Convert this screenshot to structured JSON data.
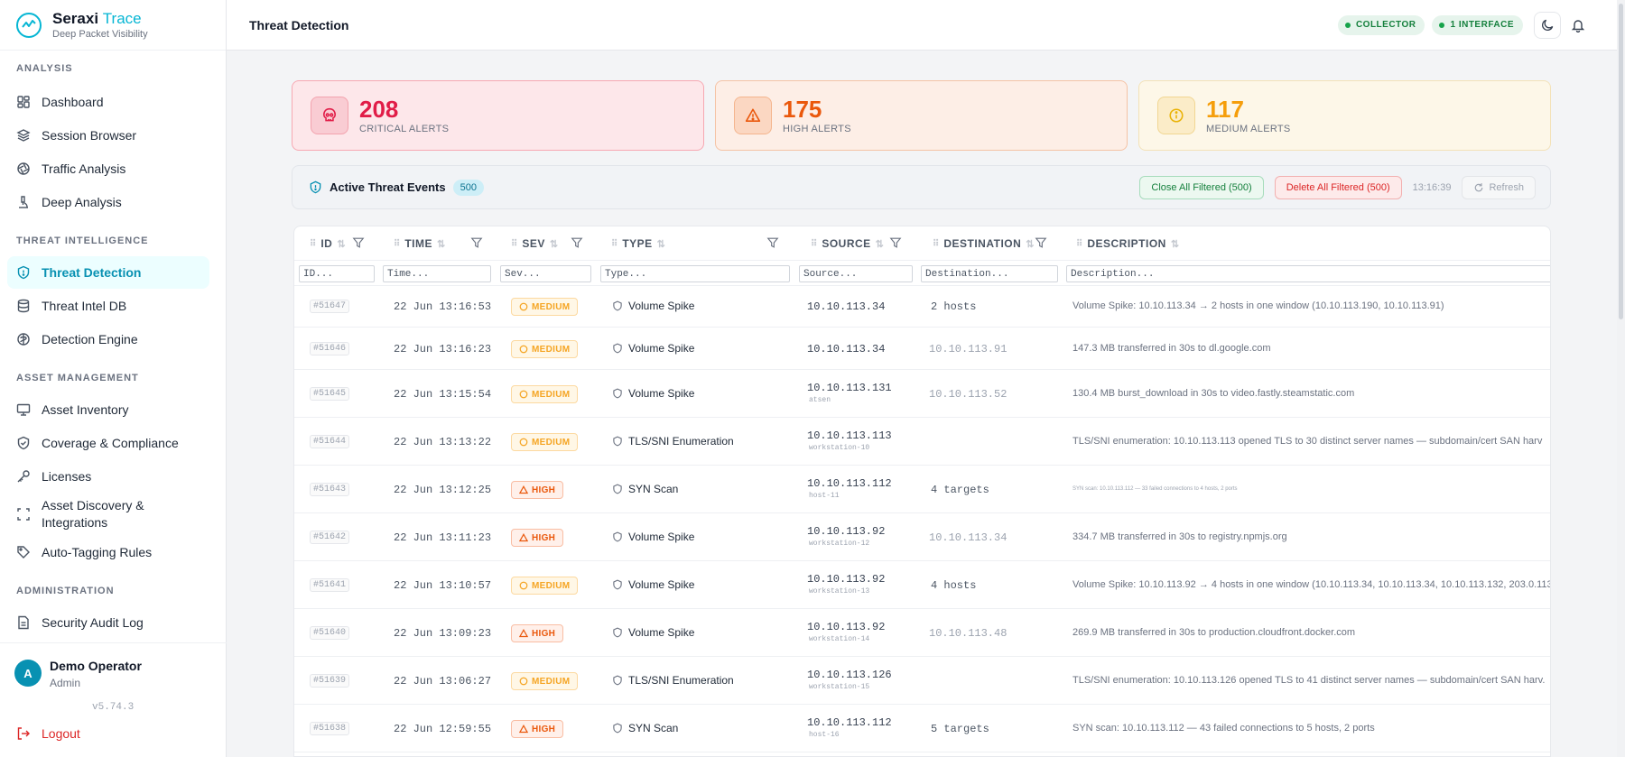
{
  "brand": {
    "name": "Seraxi",
    "accent": "Trace",
    "subtitle": "Deep Packet Visibility"
  },
  "sidebar": {
    "sections": [
      {
        "label": "ANALYSIS",
        "items": [
          {
            "label": "Dashboard",
            "icon": "dashboard-icon"
          },
          {
            "label": "Session Browser",
            "icon": "layers-icon"
          },
          {
            "label": "Traffic Analysis",
            "icon": "aperture-icon"
          },
          {
            "label": "Deep Analysis",
            "icon": "microscope-icon"
          }
        ]
      },
      {
        "label": "THREAT INTELLIGENCE",
        "items": [
          {
            "label": "Threat Detection",
            "icon": "shield-alert-icon",
            "active": true
          },
          {
            "label": "Threat Intel DB",
            "icon": "database-icon"
          },
          {
            "label": "Detection Engine",
            "icon": "cpu-icon"
          }
        ]
      },
      {
        "label": "ASSET MANAGEMENT",
        "items": [
          {
            "label": "Asset Inventory",
            "icon": "monitor-icon"
          },
          {
            "label": "Coverage & Compliance",
            "icon": "shield-check-icon"
          },
          {
            "label": "Licenses",
            "icon": "key-icon"
          },
          {
            "label": "Asset Discovery & Integrations",
            "icon": "scan-icon"
          },
          {
            "label": "Auto-Tagging Rules",
            "icon": "tag-icon"
          }
        ]
      },
      {
        "label": "ADMINISTRATION",
        "items": [
          {
            "label": "Security Audit Log",
            "icon": "file-text-icon"
          }
        ]
      }
    ]
  },
  "user": {
    "initial": "A",
    "name": "Demo Operator",
    "role": "Admin",
    "version": "v5.74.3",
    "logout_label": "Logout"
  },
  "header": {
    "title": "Threat Detection",
    "collector_label": "COLLECTOR",
    "interface_label": "1 INTERFACE"
  },
  "stats": {
    "critical": {
      "value": "208",
      "label": "CRITICAL ALERTS"
    },
    "high": {
      "value": "175",
      "label": "HIGH ALERTS"
    },
    "medium": {
      "value": "117",
      "label": "MEDIUM ALERTS"
    }
  },
  "events": {
    "title": "Active Threat Events",
    "count": "500",
    "close_label": "Close All Filtered (500)",
    "delete_label": "Delete All Filtered (500)",
    "time": "13:16:39",
    "refresh_label": "Refresh"
  },
  "table": {
    "columns": [
      "ID",
      "TIME",
      "SEV",
      "TYPE",
      "SOURCE",
      "DESTINATION",
      "DESCRIPTION"
    ],
    "filter_placeholders": [
      "ID...",
      "Time...",
      "Sev...",
      "Type...",
      "Source...",
      "Destination...",
      "Description..."
    ],
    "rows": [
      {
        "id": "#51647",
        "time": "22 Jun 13:16:53",
        "sev": "MEDIUM",
        "type": "Volume Spike",
        "source": "10.10.113.34",
        "host": "",
        "dest": "2 hosts",
        "dest_kind": "count",
        "desc": "Volume Spike: 10.10.113.34 → 2 hosts in one window (10.10.113.190, 10.10.113.91)"
      },
      {
        "id": "#51646",
        "time": "22 Jun 13:16:23",
        "sev": "MEDIUM",
        "type": "Volume Spike",
        "source": "10.10.113.34",
        "host": "",
        "dest": "10.10.113.91",
        "dest_kind": "ip",
        "desc": "147.3 MB transferred in 30s to dl.google.com"
      },
      {
        "id": "#51645",
        "time": "22 Jun 13:15:54",
        "sev": "MEDIUM",
        "type": "Volume Spike",
        "source": "10.10.113.131",
        "host": "atsen",
        "dest": "10.10.113.52",
        "dest_kind": "ip",
        "desc": "130.4 MB burst_download in 30s to video.fastly.steamstatic.com"
      },
      {
        "id": "#51644",
        "time": "22 Jun 13:13:22",
        "sev": "MEDIUM",
        "type": "TLS/SNI Enumeration",
        "source": "10.10.113.113",
        "host": "workstation-10",
        "dest": "",
        "dest_kind": "count",
        "desc": "TLS/SNI enumeration: 10.10.113.113 opened TLS to 30 distinct server names — subdomain/cert SAN harv"
      },
      {
        "id": "#51643",
        "time": "22 Jun 13:12:25",
        "sev": "HIGH",
        "type": "SYN Scan",
        "source": "10.10.113.112",
        "host": "host-11",
        "dest": "4 targets",
        "dest_kind": "count",
        "desc": "SYN scan: 10.10.113.112 — 33 failed connections to 4 hosts, 2 ports",
        "tiny": true
      },
      {
        "id": "#51642",
        "time": "22 Jun 13:11:23",
        "sev": "HIGH",
        "type": "Volume Spike",
        "source": "10.10.113.92",
        "host": "workstation-12",
        "dest": "10.10.113.34",
        "dest_kind": "ip",
        "desc": "334.7 MB transferred in 30s to registry.npmjs.org"
      },
      {
        "id": "#51641",
        "time": "22 Jun 13:10:57",
        "sev": "MEDIUM",
        "type": "Volume Spike",
        "source": "10.10.113.92",
        "host": "workstation-13",
        "dest": "4 hosts",
        "dest_kind": "count",
        "desc": "Volume Spike: 10.10.113.92 → 4 hosts in one window (10.10.113.34, 10.10.113.34, 10.10.113.132, 203.0.113."
      },
      {
        "id": "#51640",
        "time": "22 Jun 13:09:23",
        "sev": "HIGH",
        "type": "Volume Spike",
        "source": "10.10.113.92",
        "host": "workstation-14",
        "dest": "10.10.113.48",
        "dest_kind": "ip",
        "desc": "269.9 MB transferred in 30s to production.cloudfront.docker.com"
      },
      {
        "id": "#51639",
        "time": "22 Jun 13:06:27",
        "sev": "MEDIUM",
        "type": "TLS/SNI Enumeration",
        "source": "10.10.113.126",
        "host": "workstation-15",
        "dest": "",
        "dest_kind": "count",
        "desc": "TLS/SNI enumeration: 10.10.113.126 opened TLS to 41 distinct server names — subdomain/cert SAN harv."
      },
      {
        "id": "#51638",
        "time": "22 Jun 12:59:55",
        "sev": "HIGH",
        "type": "SYN Scan",
        "source": "10.10.113.112",
        "host": "host-16",
        "dest": "5 targets",
        "dest_kind": "count",
        "desc": "SYN scan: 10.10.113.112 — 43 failed connections to 5 hosts, 2 ports"
      }
    ]
  }
}
